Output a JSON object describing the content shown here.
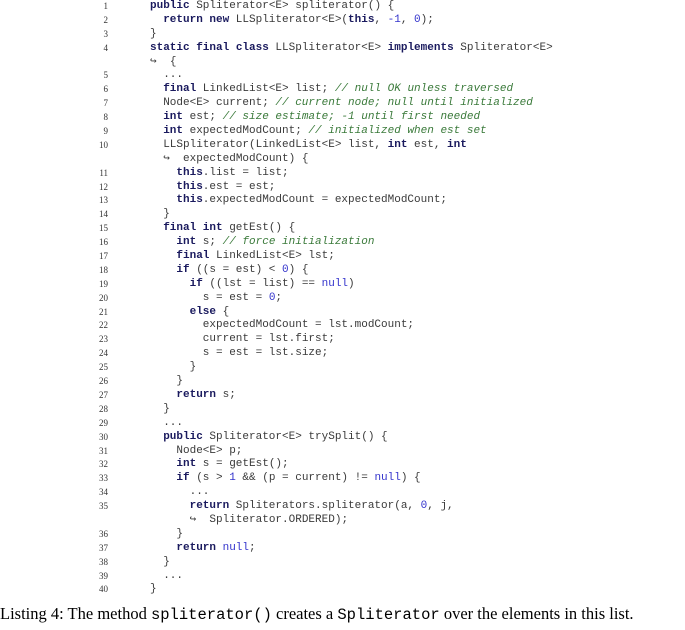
{
  "listing": {
    "lines": [
      {
        "n": "1",
        "indent": 0,
        "tokens": [
          [
            "kw",
            "public"
          ],
          [
            "txt",
            " Spliterator<E> spliterator() {"
          ]
        ]
      },
      {
        "n": "2",
        "indent": 1,
        "tokens": [
          [
            "kw",
            "return new"
          ],
          [
            "txt",
            " LLSpliterator<E>("
          ],
          [
            "kw",
            "this"
          ],
          [
            "txt",
            ", "
          ],
          [
            "num",
            "-1"
          ],
          [
            "txt",
            ", "
          ],
          [
            "num",
            "0"
          ],
          [
            "txt",
            ");"
          ]
        ]
      },
      {
        "n": "3",
        "indent": 0,
        "tokens": [
          [
            "txt",
            "}"
          ]
        ]
      },
      {
        "n": "4",
        "indent": 0,
        "tokens": [
          [
            "kw",
            "static final class"
          ],
          [
            "txt",
            " LLSpliterator<E> "
          ],
          [
            "kw",
            "implements"
          ],
          [
            "txt",
            " Spliterator<E>"
          ]
        ]
      },
      {
        "n": "",
        "indent": 0,
        "tokens": [
          [
            "txt",
            "↪  {"
          ]
        ]
      },
      {
        "n": "5",
        "indent": 1,
        "tokens": [
          [
            "txt",
            "..."
          ]
        ]
      },
      {
        "n": "6",
        "indent": 1,
        "tokens": [
          [
            "kw",
            "final"
          ],
          [
            "txt",
            " LinkedList<E> list; "
          ],
          [
            "cm",
            "// null OK unless traversed"
          ]
        ]
      },
      {
        "n": "7",
        "indent": 1,
        "tokens": [
          [
            "txt",
            "Node<E> current; "
          ],
          [
            "cm",
            "// current node; null until initialized"
          ]
        ]
      },
      {
        "n": "8",
        "indent": 1,
        "tokens": [
          [
            "kw",
            "int"
          ],
          [
            "txt",
            " est; "
          ],
          [
            "cm",
            "// size estimate; -1 until first needed"
          ]
        ]
      },
      {
        "n": "9",
        "indent": 1,
        "tokens": [
          [
            "kw",
            "int"
          ],
          [
            "txt",
            " expectedModCount; "
          ],
          [
            "cm",
            "// initialized when est set"
          ]
        ]
      },
      {
        "n": "10",
        "indent": 1,
        "tokens": [
          [
            "txt",
            "LLSpliterator(LinkedList<E> list, "
          ],
          [
            "kw",
            "int"
          ],
          [
            "txt",
            " est, "
          ],
          [
            "kw",
            "int"
          ]
        ]
      },
      {
        "n": "",
        "indent": 1,
        "tokens": [
          [
            "txt",
            "↪  expectedModCount) {"
          ]
        ]
      },
      {
        "n": "11",
        "indent": 2,
        "tokens": [
          [
            "kw",
            "this"
          ],
          [
            "txt",
            ".list = list;"
          ]
        ]
      },
      {
        "n": "12",
        "indent": 2,
        "tokens": [
          [
            "kw",
            "this"
          ],
          [
            "txt",
            ".est = est;"
          ]
        ]
      },
      {
        "n": "13",
        "indent": 2,
        "tokens": [
          [
            "kw",
            "this"
          ],
          [
            "txt",
            ".expectedModCount = expectedModCount;"
          ]
        ]
      },
      {
        "n": "14",
        "indent": 1,
        "tokens": [
          [
            "txt",
            "}"
          ]
        ]
      },
      {
        "n": "15",
        "indent": 1,
        "tokens": [
          [
            "kw",
            "final int"
          ],
          [
            "txt",
            " getEst() {"
          ]
        ]
      },
      {
        "n": "16",
        "indent": 2,
        "tokens": [
          [
            "kw",
            "int"
          ],
          [
            "txt",
            " s; "
          ],
          [
            "cm",
            "// force initialization"
          ]
        ]
      },
      {
        "n": "17",
        "indent": 2,
        "tokens": [
          [
            "kw",
            "final"
          ],
          [
            "txt",
            " LinkedList<E> lst;"
          ]
        ]
      },
      {
        "n": "18",
        "indent": 2,
        "tokens": [
          [
            "kw",
            "if"
          ],
          [
            "txt",
            " ((s = est) < "
          ],
          [
            "num",
            "0"
          ],
          [
            "txt",
            ") {"
          ]
        ]
      },
      {
        "n": "19",
        "indent": 3,
        "tokens": [
          [
            "kw",
            "if"
          ],
          [
            "txt",
            " ((lst = list) == "
          ],
          [
            "num",
            "null"
          ],
          [
            "txt",
            ")"
          ]
        ]
      },
      {
        "n": "20",
        "indent": 4,
        "tokens": [
          [
            "txt",
            "s = est = "
          ],
          [
            "num",
            "0"
          ],
          [
            "txt",
            ";"
          ]
        ]
      },
      {
        "n": "21",
        "indent": 3,
        "tokens": [
          [
            "kw",
            "else"
          ],
          [
            "txt",
            " {"
          ]
        ]
      },
      {
        "n": "22",
        "indent": 4,
        "tokens": [
          [
            "txt",
            "expectedModCount = lst.modCount;"
          ]
        ]
      },
      {
        "n": "23",
        "indent": 4,
        "tokens": [
          [
            "txt",
            "current = lst.first;"
          ]
        ]
      },
      {
        "n": "24",
        "indent": 4,
        "tokens": [
          [
            "txt",
            "s = est = lst.size;"
          ]
        ]
      },
      {
        "n": "25",
        "indent": 3,
        "tokens": [
          [
            "txt",
            "}"
          ]
        ]
      },
      {
        "n": "26",
        "indent": 2,
        "tokens": [
          [
            "txt",
            "}"
          ]
        ]
      },
      {
        "n": "27",
        "indent": 2,
        "tokens": [
          [
            "kw",
            "return"
          ],
          [
            "txt",
            " s;"
          ]
        ]
      },
      {
        "n": "28",
        "indent": 1,
        "tokens": [
          [
            "txt",
            "}"
          ]
        ]
      },
      {
        "n": "29",
        "indent": 1,
        "tokens": [
          [
            "txt",
            "..."
          ]
        ]
      },
      {
        "n": "30",
        "indent": 1,
        "tokens": [
          [
            "kw",
            "public"
          ],
          [
            "txt",
            " Spliterator<E> trySplit() {"
          ]
        ]
      },
      {
        "n": "31",
        "indent": 2,
        "tokens": [
          [
            "txt",
            "Node<E> p;"
          ]
        ]
      },
      {
        "n": "32",
        "indent": 2,
        "tokens": [
          [
            "kw",
            "int"
          ],
          [
            "txt",
            " s = getEst();"
          ]
        ]
      },
      {
        "n": "33",
        "indent": 2,
        "tokens": [
          [
            "kw",
            "if"
          ],
          [
            "txt",
            " (s > "
          ],
          [
            "num",
            "1"
          ],
          [
            "txt",
            " && (p = current) != "
          ],
          [
            "num",
            "null"
          ],
          [
            "txt",
            ") {"
          ]
        ]
      },
      {
        "n": "34",
        "indent": 3,
        "tokens": [
          [
            "txt",
            "..."
          ]
        ]
      },
      {
        "n": "35",
        "indent": 3,
        "tokens": [
          [
            "kw",
            "return"
          ],
          [
            "txt",
            " Spliterators.spliterator(a, "
          ],
          [
            "num",
            "0"
          ],
          [
            "txt",
            ", j,"
          ]
        ]
      },
      {
        "n": "",
        "indent": 3,
        "tokens": [
          [
            "txt",
            "↪  Spliterator.ORDERED);"
          ]
        ]
      },
      {
        "n": "36",
        "indent": 2,
        "tokens": [
          [
            "txt",
            "}"
          ]
        ]
      },
      {
        "n": "37",
        "indent": 2,
        "tokens": [
          [
            "kw",
            "return"
          ],
          [
            "txt",
            " "
          ],
          [
            "num",
            "null"
          ],
          [
            "txt",
            ";"
          ]
        ]
      },
      {
        "n": "38",
        "indent": 1,
        "tokens": [
          [
            "txt",
            "}"
          ]
        ]
      },
      {
        "n": "39",
        "indent": 1,
        "tokens": [
          [
            "txt",
            "..."
          ]
        ]
      },
      {
        "n": "40",
        "indent": 0,
        "tokens": [
          [
            "txt",
            "}"
          ]
        ]
      }
    ]
  },
  "caption": {
    "label": "Listing 4:",
    "text_1": " The method ",
    "code_1": "spliterator()",
    "text_2": " creates a ",
    "code_2": "Spliterator",
    "text_3": " over the elements in this list."
  }
}
